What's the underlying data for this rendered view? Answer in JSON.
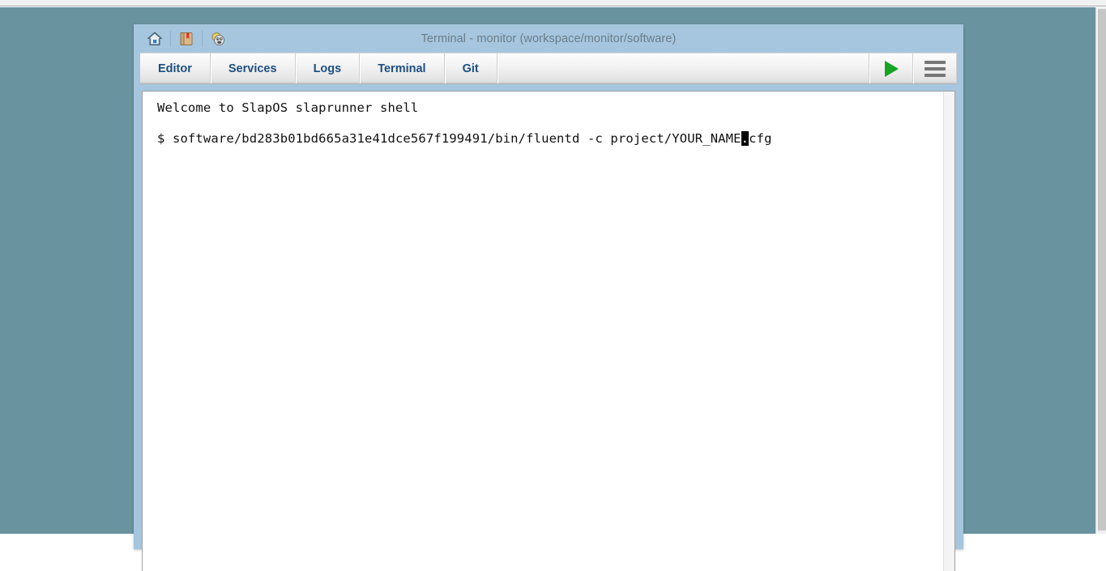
{
  "window": {
    "title": "Terminal - monitor (workspace/monitor/software)",
    "titlebar_icons": [
      {
        "name": "home-icon",
        "label": "Home"
      },
      {
        "name": "book-icon",
        "label": "Documentation"
      },
      {
        "name": "mask-icon",
        "label": "Support"
      }
    ]
  },
  "nav": {
    "tabs": [
      {
        "label": "Editor"
      },
      {
        "label": "Services"
      },
      {
        "label": "Logs"
      },
      {
        "label": "Terminal"
      },
      {
        "label": "Git"
      }
    ],
    "actions": [
      {
        "name": "run-button",
        "label": "Run"
      },
      {
        "name": "menu-button",
        "label": "Menu"
      }
    ]
  },
  "terminal": {
    "welcome_line": "Welcome to SlapOS slaprunner shell",
    "prompt": "$ ",
    "command_before_cursor": "software/bd283b01bd665a31e41dce567f199491/bin/fluentd -c project/YOUR_NAME",
    "cursor_char": ".",
    "command_after_cursor": "cfg"
  },
  "colors": {
    "page_background": "#6a93a0",
    "window_frame": "#a5c6de",
    "tab_text": "#1c4f82",
    "title_text": "#6c7d88",
    "run_icon": "#16a422",
    "terminal_background": "#ffffff",
    "terminal_text": "#111111"
  }
}
